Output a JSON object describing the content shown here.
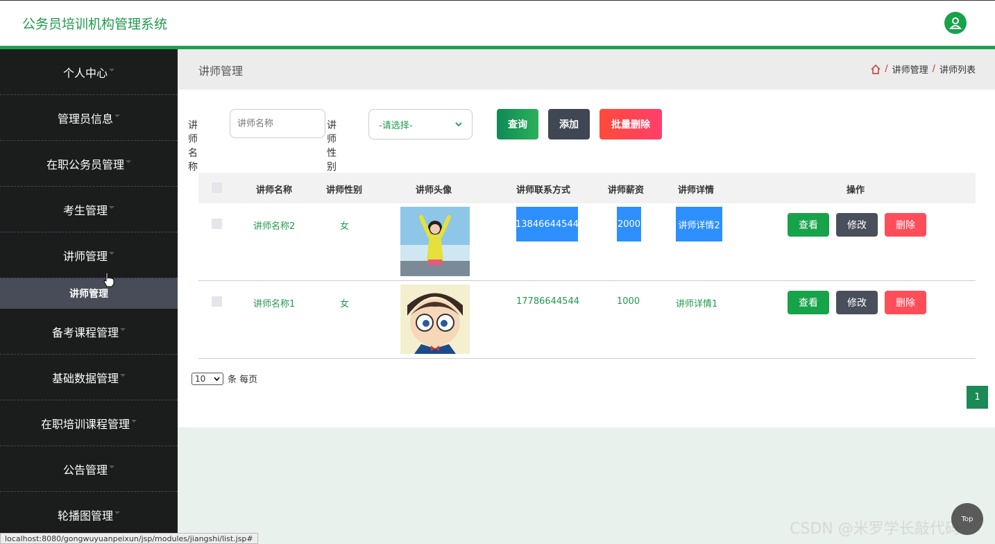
{
  "app": {
    "title": "公务员培训机构管理系统"
  },
  "sidebar": {
    "items": [
      {
        "label": "个人中心"
      },
      {
        "label": "管理员信息"
      },
      {
        "label": "在职公务员管理"
      },
      {
        "label": "考生管理"
      },
      {
        "label": "讲师管理"
      },
      {
        "label": "备考课程管理"
      },
      {
        "label": "基础数据管理"
      },
      {
        "label": "在职培训课程管理"
      },
      {
        "label": "公告管理"
      },
      {
        "label": "轮播图管理"
      }
    ],
    "active_sub": "讲师管理"
  },
  "page": {
    "title": "讲师管理",
    "breadcrumb": [
      "讲师管理",
      "讲师列表"
    ]
  },
  "search": {
    "name_label": "讲师名称",
    "name_placeholder": "讲师名称",
    "gender_label": "讲师性别",
    "gender_value": "-请选择-",
    "query_label": "查询",
    "add_label": "添加",
    "batch_delete_label": "批量删除"
  },
  "table": {
    "headers": [
      "讲师名称",
      "讲师性别",
      "讲师头像",
      "讲师联系方式",
      "讲师薪资",
      "讲师详情",
      "操作"
    ],
    "rows": [
      {
        "name": "讲师名称2",
        "gender": "女",
        "phone": "13846644544",
        "salary": "2000",
        "detail": "讲师详情2"
      },
      {
        "name": "讲师名称1",
        "gender": "女",
        "phone": "17786644544",
        "salary": "1000",
        "detail": "讲师详情1"
      }
    ],
    "actions": {
      "view": "查看",
      "edit": "修改",
      "delete": "删除"
    }
  },
  "pagination": {
    "page_size": "10",
    "per_page_label": "条 每页",
    "current_page": "1"
  },
  "footer": {
    "top_label": "Top",
    "watermark": "CSDN @米罗学长敲代码",
    "status_url": "localhost:8080/gongwuyuanpeixun/jsp/modules/jiangshi/list.jsp#"
  },
  "colors": {
    "brand": "#1aa251",
    "sidebar_bg": "#1b1d1c",
    "highlight": "#2e8fff",
    "danger": "#ff4d5a"
  }
}
